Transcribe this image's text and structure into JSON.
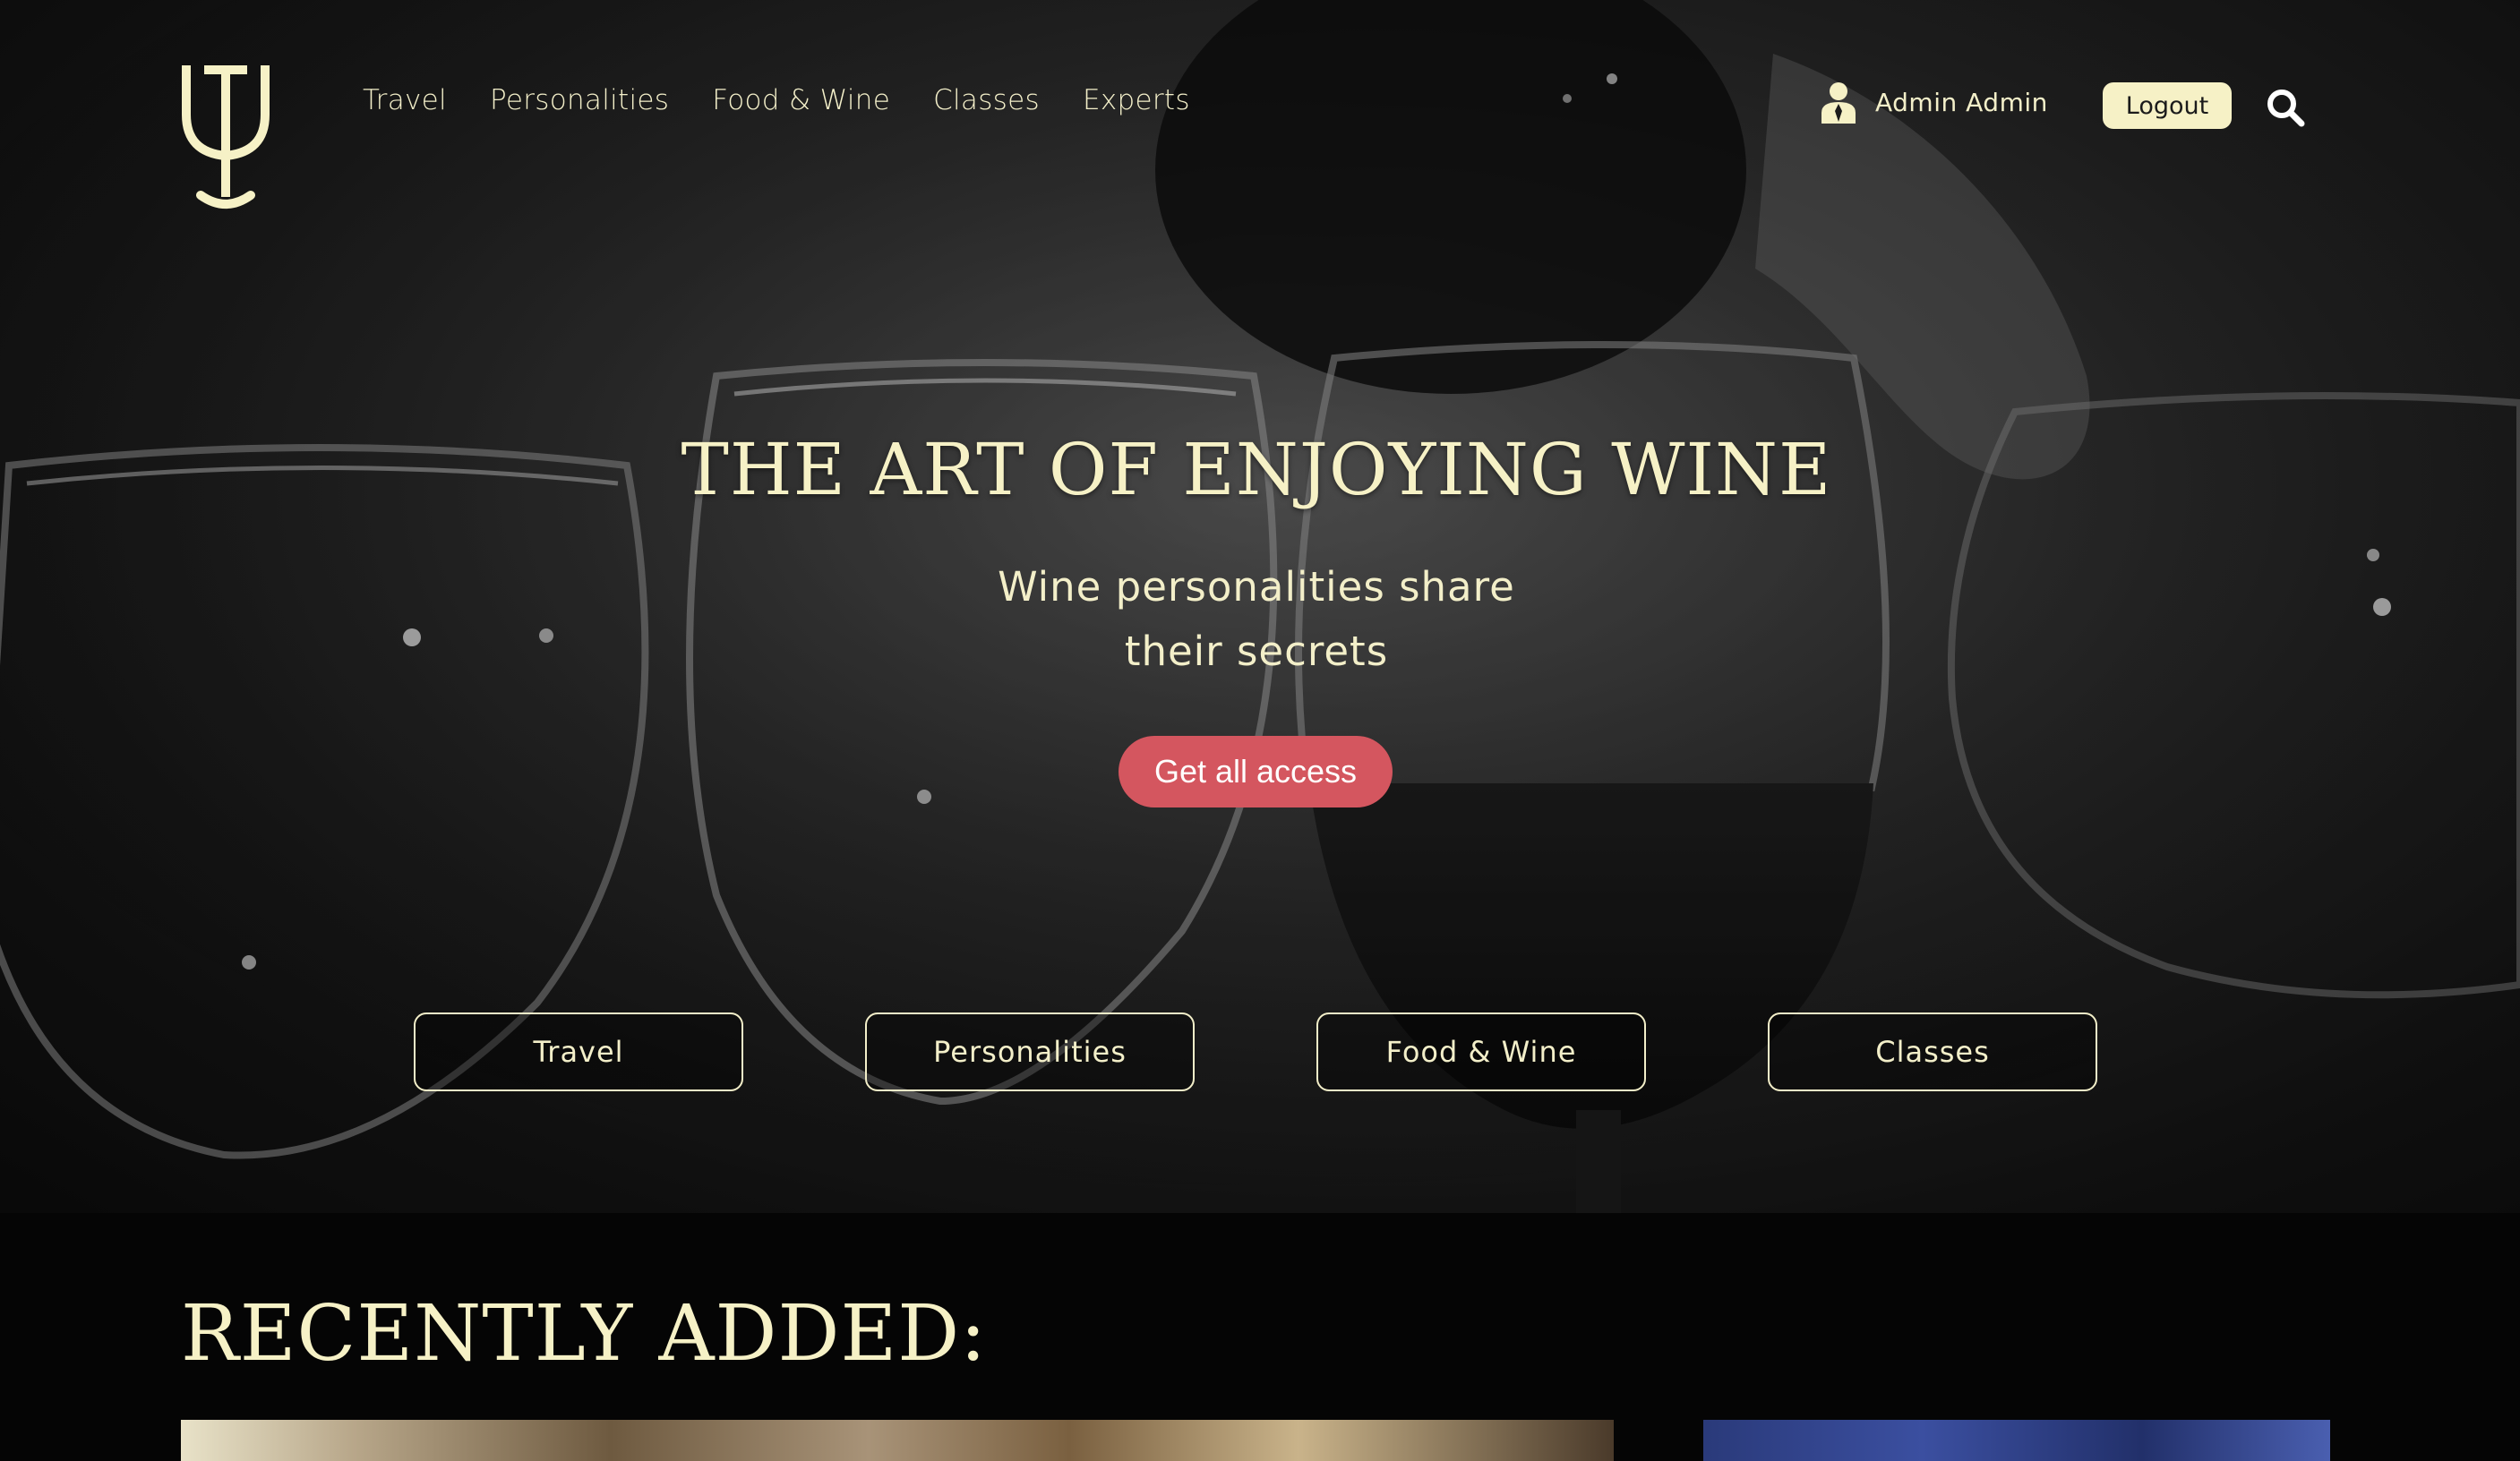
{
  "nav": {
    "items": [
      {
        "label": "Travel"
      },
      {
        "label": "Personalities"
      },
      {
        "label": "Food & Wine"
      },
      {
        "label": "Classes"
      },
      {
        "label": "Experts"
      }
    ],
    "user_name": "Admin Admin",
    "logout_label": "Logout",
    "icons": [
      "wine-glass-logo-icon",
      "user-icon",
      "search-icon"
    ]
  },
  "hero": {
    "headline": "THE ART OF ENJOYING WINE",
    "subhead_line1": "Wine personalities share",
    "subhead_line2": "their secrets",
    "cta_label": "Get all access",
    "categories": [
      {
        "label": "Travel"
      },
      {
        "label": "Personalities"
      },
      {
        "label": "Food & Wine"
      },
      {
        "label": "Classes"
      }
    ]
  },
  "recent": {
    "title": "RECENTLY ADDED:"
  },
  "colors": {
    "accent_cream": "#f6f1c6",
    "cta_red": "#d4565f",
    "page_bg": "#050505"
  }
}
